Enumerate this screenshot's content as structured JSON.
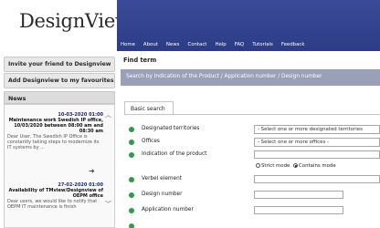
{
  "logo": {
    "text": "DesignView"
  },
  "sidebar": {
    "invite_label": "Invite your friend to Designview",
    "favourites_label": "Add Designview to my favourites",
    "news_header": "News",
    "news": [
      {
        "date": "10-03-2020 01:00",
        "title": "Maintenance work Swedish IP office, 10/03/2020 between 08:00 am and 08:30 am",
        "text": "Dear User, The Swedish IP Office is constantly taking steps to modernize its IT systems by ..."
      },
      {
        "date": "27-02-2020 01:00",
        "title": "Availability of TMview/Designview of OEPM office",
        "text": "Dear users, we would like to notify that OEPM IT maintenance is finish"
      }
    ]
  },
  "nav": [
    "Home",
    "About",
    "News",
    "Contact",
    "Help",
    "FAQ",
    "Tutorials",
    "Feedback"
  ],
  "find": {
    "header": "Find term",
    "bar_text": "Search by Indication of the Product / Application number / Design number",
    "tab_label": "Basic search"
  },
  "form": {
    "designated_territories_label": "Designated territories",
    "designated_territories_value": "- Select one or more designated territories",
    "offices_label": "Offices",
    "offices_value": "- Select one or more offices -",
    "indication_label": "Indication of the product",
    "mode_strict": "Strict mode",
    "mode_contains": "Contains mode",
    "verbal_label": "Verbel element",
    "design_number_label": "Design number",
    "application_number_label": "Application number"
  },
  "colors": {
    "topbar": "#2f3f8a",
    "find_bar": "#9aa0b8",
    "status_dot": "#2e9c47"
  }
}
